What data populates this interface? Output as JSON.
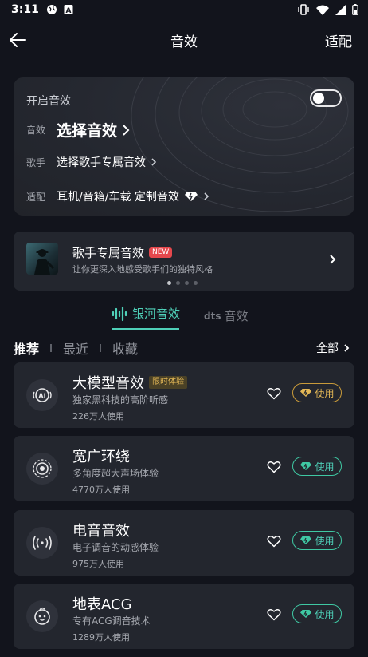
{
  "status_bar": {
    "time": "3:11"
  },
  "top_bar": {
    "title": "音效",
    "right_action": "适配"
  },
  "main_card": {
    "open_label": "开启音效",
    "toggle_on": false,
    "effect_label": "音效",
    "effect_value": "选择音效",
    "singer_label": "歌手",
    "singer_value": "选择歌手专属音效",
    "adapt_label": "适配",
    "adapt_value": "耳机/音箱/车载 定制音效"
  },
  "banner": {
    "title": "歌手专属音效",
    "badge": "NEW",
    "subtitle": "让你更深入地感受歌手们的独特风格",
    "page_count": 4,
    "active_page": 1
  },
  "segment_tabs": [
    {
      "label": "银河音效",
      "active": true
    },
    {
      "logo": "dts",
      "label": "音效",
      "active": false
    }
  ],
  "category_tabs": [
    {
      "label": "推荐",
      "active": true
    },
    {
      "label": "最近",
      "active": false
    },
    {
      "label": "收藏",
      "active": false
    }
  ],
  "all_label": "全部",
  "effects": [
    {
      "name": "大模型音效",
      "badge": "限时体验",
      "desc": "独家黑科技的高阶听感",
      "users": "226万人使用",
      "button": "使用",
      "button_style": "gold",
      "icon": "ai-icon"
    },
    {
      "name": "宽广环绕",
      "badge": "",
      "desc": "多角度超大声场体验",
      "users": "4770万人使用",
      "button": "使用",
      "button_style": "green",
      "icon": "surround-icon"
    },
    {
      "name": "电音音效",
      "badge": "",
      "desc": "电子调音的动感体验",
      "users": "975万人使用",
      "button": "使用",
      "button_style": "green",
      "icon": "sound-wave-icon"
    },
    {
      "name": "地表ACG",
      "badge": "",
      "desc": "专有ACG调音技术",
      "users": "1289万人使用",
      "button": "使用",
      "button_style": "green",
      "icon": "anime-face-icon"
    }
  ],
  "colors": {
    "background": "#12141c",
    "card": "#23262e",
    "accent_green": "#4fd0b8",
    "accent_gold": "#e3b756"
  }
}
